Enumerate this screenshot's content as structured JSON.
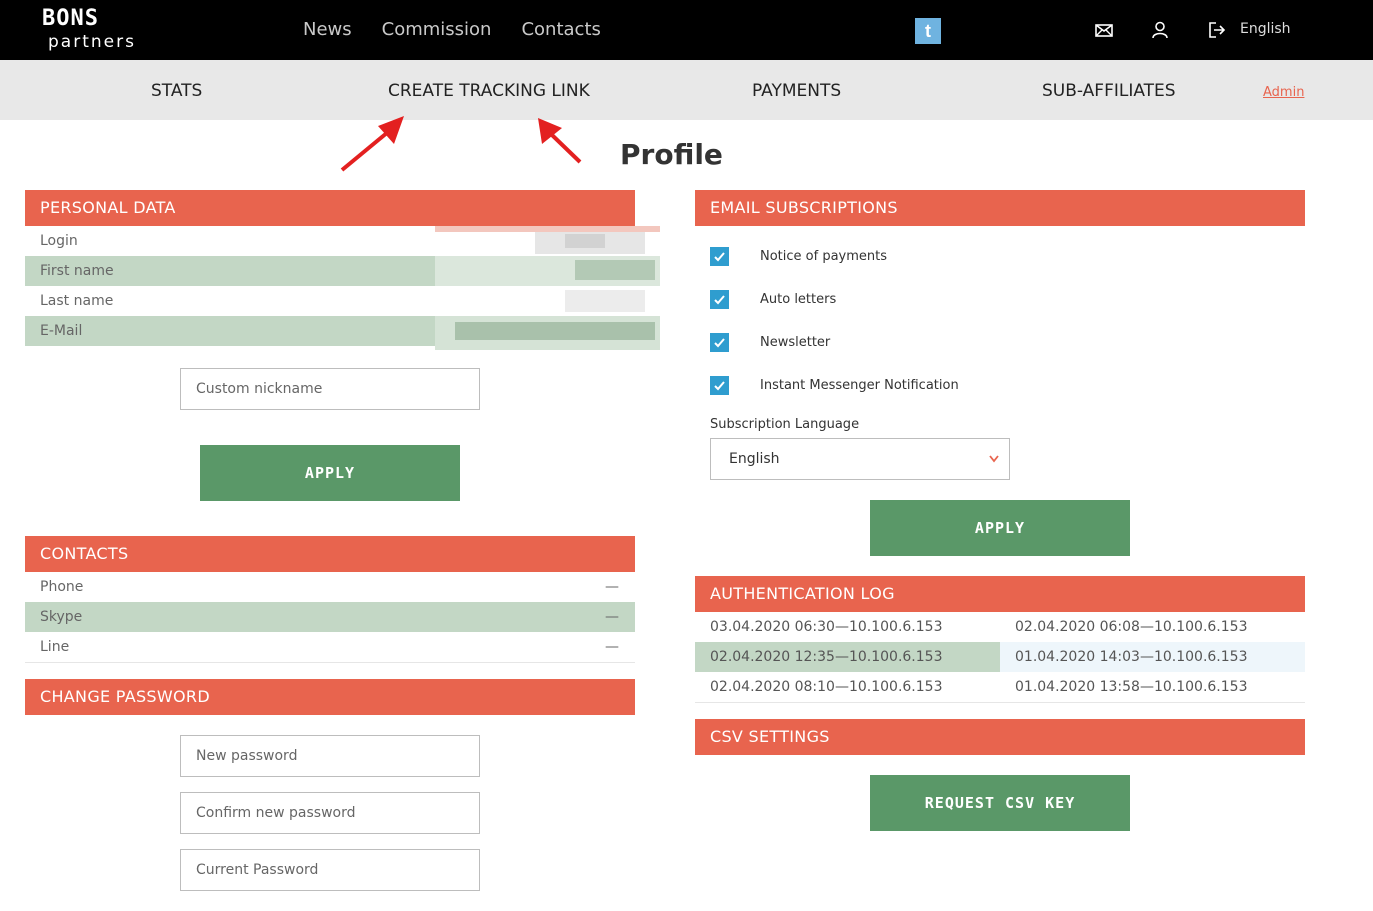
{
  "brand": {
    "logo_top": "BONS",
    "logo_bottom": "partners"
  },
  "top_nav": [
    {
      "label": "News"
    },
    {
      "label": "Commission"
    },
    {
      "label": "Contacts"
    }
  ],
  "top_icons": {
    "twitter_glyph": "t",
    "mail": "mail-icon",
    "user": "user-icon",
    "logout": "logout-icon"
  },
  "language": "English",
  "sub_nav": {
    "stats": "STATS",
    "create_tracking_link": "CREATE TRACKING LINK",
    "payments": "PAYMENTS",
    "sub_affiliates": "SUB-AFFILIATES",
    "admin": "Admin"
  },
  "page_title": "Profile",
  "personal_data": {
    "title": "PERSONAL DATA",
    "rows": [
      {
        "label": "Login"
      },
      {
        "label": "First name"
      },
      {
        "label": "Last name"
      },
      {
        "label": "E-Mail"
      }
    ],
    "nickname_placeholder": "Custom nickname",
    "apply_label": "APPLY"
  },
  "contacts": {
    "title": "CONTACTS",
    "rows": [
      {
        "label": "Phone",
        "value": "—"
      },
      {
        "label": "Skype",
        "value": "—"
      },
      {
        "label": "Line",
        "value": "—"
      }
    ]
  },
  "change_password": {
    "title": "CHANGE PASSWORD",
    "new_placeholder": "New password",
    "confirm_placeholder": "Confirm new password",
    "current_placeholder": "Current Password"
  },
  "email_subscriptions": {
    "title": "EMAIL SUBSCRIPTIONS",
    "items": [
      {
        "label": "Notice of payments",
        "checked": true
      },
      {
        "label": "Auto letters",
        "checked": true
      },
      {
        "label": "Newsletter",
        "checked": true
      },
      {
        "label": "Instant Messenger Notification",
        "checked": true
      }
    ],
    "language_label": "Subscription Language",
    "language_value": "English",
    "apply_label": "APPLY"
  },
  "auth_log": {
    "title": "AUTHENTICATION LOG",
    "entries": [
      "03.04.2020 06:30—10.100.6.153",
      "02.04.2020 06:08—10.100.6.153",
      "02.04.2020 12:35—10.100.6.153",
      "01.04.2020 14:03—10.100.6.153",
      "02.04.2020 08:10—10.100.6.153",
      "01.04.2020 13:58—10.100.6.153"
    ]
  },
  "csv_settings": {
    "title": "CSV SETTINGS",
    "button_label": "REQUEST CSV KEY"
  },
  "colors": {
    "accent": "#e8644e",
    "button": "#5a9868",
    "row_highlight": "#c3d7c5",
    "checkbox": "#2f9dcf",
    "topbar": "#000000",
    "subnav": "#e8e8e8"
  }
}
